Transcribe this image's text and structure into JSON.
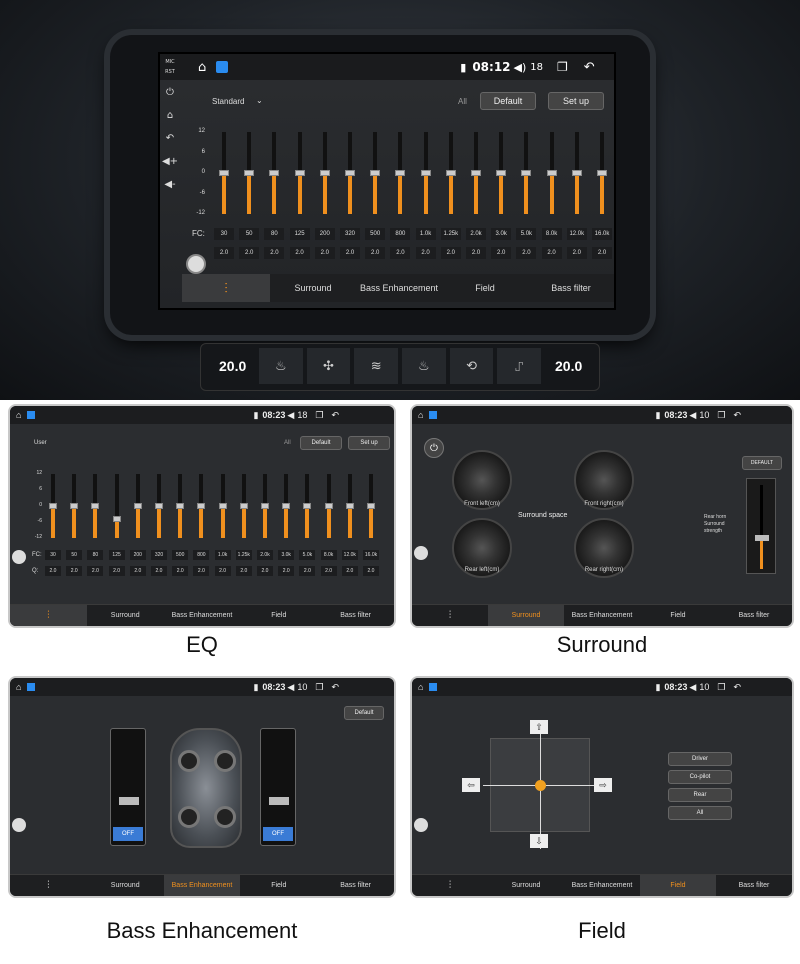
{
  "main": {
    "status": {
      "time": "08:12",
      "volume": "18"
    },
    "preset": "Standard",
    "all_label": "All",
    "default_btn": "Default",
    "setup_btn": "Set up",
    "yaxis": [
      "12",
      "6",
      "0",
      "-6",
      "-12"
    ],
    "fc_label": "FC:",
    "fc": [
      "30",
      "50",
      "80",
      "125",
      "200",
      "320",
      "500",
      "800",
      "1.0k",
      "1.25k",
      "2.0k",
      "3.0k",
      "5.0k",
      "8.0k",
      "12.0k",
      "16.0k"
    ],
    "q": [
      "2.0",
      "2.0",
      "2.0",
      "2.0",
      "2.0",
      "2.0",
      "2.0",
      "2.0",
      "2.0",
      "2.0",
      "2.0",
      "2.0",
      "2.0",
      "2.0",
      "2.0",
      "2.0"
    ],
    "levels": [
      0,
      0,
      0,
      0,
      0,
      0,
      0,
      0,
      0,
      0,
      0,
      0,
      0,
      0,
      0,
      0
    ],
    "tabs": [
      "Surround",
      "Bass Enhancement",
      "Field",
      "Bass filter"
    ],
    "temp_left": "20.0",
    "temp_right": "20.0"
  },
  "sidebar": {
    "mic": "MIC",
    "rst": "RST"
  },
  "eq": {
    "status": {
      "time": "08:23",
      "volume": "18"
    },
    "preset": "User",
    "all_label": "All",
    "default_btn": "Default",
    "setup_btn": "Set up",
    "yaxis": [
      "12",
      "6",
      "0",
      "-6",
      "-12"
    ],
    "fc_label": "FC:",
    "q_label": "Q:",
    "fc": [
      "30",
      "50",
      "80",
      "125",
      "200",
      "320",
      "500",
      "800",
      "1.0k",
      "1.25k",
      "2.0k",
      "3.0k",
      "5.0k",
      "8.0k",
      "12.0k",
      "16.0k"
    ],
    "q": [
      "2.0",
      "2.0",
      "2.0",
      "2.0",
      "2.0",
      "2.0",
      "2.0",
      "2.0",
      "2.0",
      "2.0",
      "2.0",
      "2.0",
      "2.0",
      "2.0",
      "2.0",
      "2.0"
    ],
    "levels": [
      0,
      0,
      0,
      -5,
      0,
      0,
      0,
      0,
      0,
      0,
      0,
      0,
      0,
      0,
      0,
      0
    ],
    "tabs": [
      "Surround",
      "Bass Enhancement",
      "Field",
      "Bass filter"
    ],
    "caption": "EQ"
  },
  "surround": {
    "status": {
      "time": "08:23",
      "volume": "10"
    },
    "default_btn": "DEFAULT",
    "gauges": [
      "Front left(cm)",
      "Front right(cm)",
      "Rear left(cm)",
      "Rear right(cm)"
    ],
    "center": "Surround space",
    "rear_label": "Rear horn Surround strength",
    "tabs": [
      "Surround",
      "Bass Enhancement",
      "Field",
      "Bass filter"
    ],
    "caption": "Surround"
  },
  "bass": {
    "status": {
      "time": "08:23",
      "volume": "10"
    },
    "default_btn": "Default",
    "off_label": "OFF",
    "tabs": [
      "Surround",
      "Bass Enhancement",
      "Field",
      "Bass filter"
    ],
    "caption": "Bass Enhancement"
  },
  "field": {
    "status": {
      "time": "08:23",
      "volume": "10"
    },
    "options": [
      "Driver",
      "Co-pilot",
      "Rear",
      "All"
    ],
    "tabs": [
      "Surround",
      "Bass Enhancement",
      "Field",
      "Bass filter"
    ],
    "caption": "Field"
  }
}
